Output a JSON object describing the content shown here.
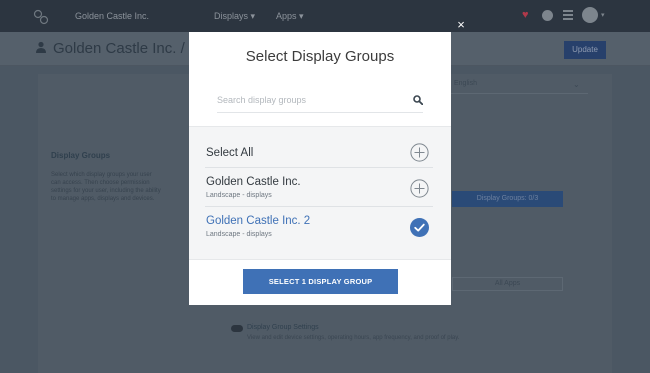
{
  "app": {
    "brand": "Golden Castle Inc.",
    "nav_displays": "Displays",
    "nav_apps": "Apps",
    "page_title": "Golden Castle Inc. / Us",
    "update_label": "Update",
    "language_value": "English",
    "display_groups_heading": "Display Groups",
    "display_groups_desc": "Select which display groups your user can access. Then choose permission settings for your user, including the ability to manage apps, displays and devices.",
    "display_groups_button": "Display Groups: 0/3",
    "all_apps_button": "All Apps",
    "settings_label": "Display Group Settings",
    "settings_desc": "View and edit device settings, operating hours, app frequency, and proof of play."
  },
  "modal": {
    "close_glyph": "×",
    "title": "Select Display Groups",
    "search_placeholder": "Search display groups",
    "select_all_label": "Select All",
    "items": [
      {
        "name": "Golden Castle Inc.",
        "subtitle": "Landscape - displays",
        "selected": false
      },
      {
        "name": "Golden Castle Inc. 2",
        "subtitle": "Landscape - displays",
        "selected": true
      }
    ],
    "confirm_label": "SELECT 1 DISPLAY GROUP"
  },
  "colors": {
    "accent": "#3f71b6",
    "overlay": "#4b5763",
    "topbar": "#2c3540"
  },
  "icons": {
    "logo": "logo-icon",
    "heart": "heart-icon",
    "help": "help-icon",
    "grid": "grid-icon",
    "user": "user-icon",
    "search": "search-icon",
    "add": "add-circle-icon",
    "check": "check-circle-icon",
    "close": "close-icon"
  }
}
